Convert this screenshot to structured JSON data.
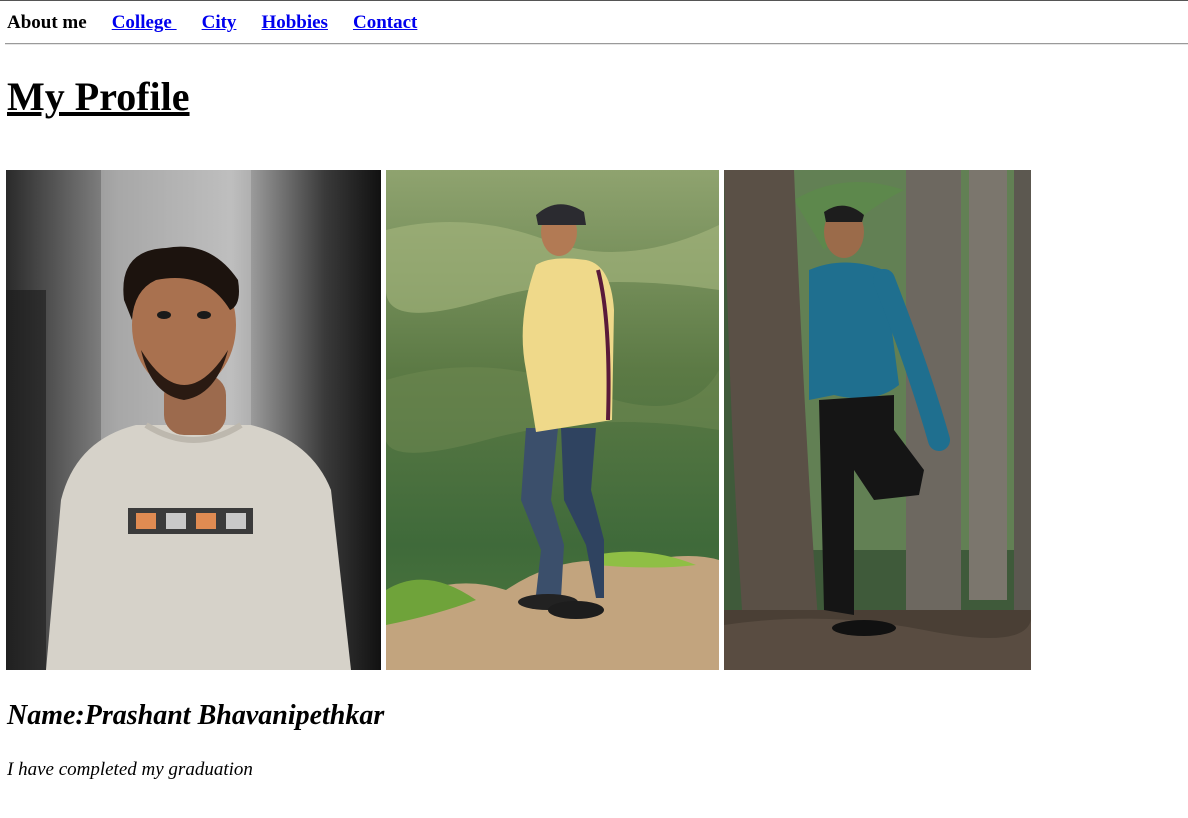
{
  "nav": {
    "items": [
      {
        "label": "About me",
        "link": false
      },
      {
        "label": "College ",
        "link": true
      },
      {
        "label": "City",
        "link": true
      },
      {
        "label": "Hobbies",
        "link": true
      },
      {
        "label": "Contact",
        "link": true
      }
    ]
  },
  "page": {
    "title": "My Profile",
    "name": "Name:Prashant Bhavanipethkar",
    "description": "I have completed my graduation"
  },
  "photos": [
    {
      "subject": "portrait-grey-sweatshirt-photo"
    },
    {
      "subject": "mountain-yellow-shirt-photo"
    },
    {
      "subject": "palm-trees-blue-shirt-photo"
    }
  ],
  "colors": {
    "link": "#0000ee",
    "text": "#000000",
    "background": "#ffffff"
  }
}
